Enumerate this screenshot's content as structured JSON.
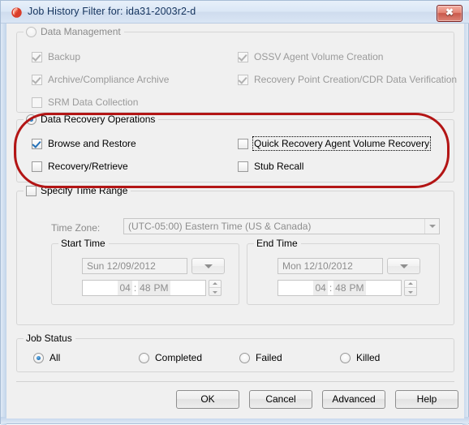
{
  "window": {
    "title": "Job History Filter for: ida31-2003r2-d",
    "icon": "commvault-swirl-icon",
    "close_label": "✖",
    "accent_close": "#c9584a",
    "frame_color": "#cfdcee"
  },
  "annotation": {
    "shape": "rounded-rectangle",
    "color": "#b31515",
    "targets": "Data Recovery Operations group"
  },
  "groups": {
    "data_management": {
      "title": "Data Management",
      "selected": false,
      "enabled": false,
      "options": [
        {
          "label": "Backup",
          "checked": true,
          "enabled": false
        },
        {
          "label": "Archive/Compliance Archive",
          "checked": true,
          "enabled": false
        },
        {
          "label": "SRM Data Collection",
          "checked": false,
          "enabled": false
        },
        {
          "label": "OSSV Agent Volume Creation",
          "checked": true,
          "enabled": false
        },
        {
          "label": "Recovery Point Creation/CDR Data Verification",
          "checked": true,
          "enabled": false
        }
      ]
    },
    "data_recovery": {
      "title": "Data Recovery Operations",
      "selected": true,
      "enabled": true,
      "options": [
        {
          "label": "Browse and Restore",
          "checked": true,
          "enabled": true,
          "focused": false
        },
        {
          "label": "Recovery/Retrieve",
          "checked": false,
          "enabled": true,
          "focused": false
        },
        {
          "label": "Quick Recovery Agent Volume Recovery",
          "checked": false,
          "enabled": true,
          "focused": true
        },
        {
          "label": "Stub Recall",
          "checked": false,
          "enabled": true,
          "focused": false
        }
      ]
    },
    "time_range": {
      "title": "Specify Time Range",
      "checked": false,
      "enabled": true,
      "timezone_label": "Time Zone:",
      "timezone_value": "(UTC-05:00) Eastern Time (US & Canada)",
      "start": {
        "title": "Start Time",
        "date": "Sun 12/09/2012",
        "hour": "04",
        "separator": ":",
        "minute": "48",
        "meridiem": "PM"
      },
      "end": {
        "title": "End Time",
        "date": "Mon 12/10/2012",
        "hour": "04",
        "separator": ":",
        "minute": "48",
        "meridiem": "PM"
      }
    },
    "job_status": {
      "title": "Job Status",
      "options": [
        {
          "label": "All",
          "selected": true
        },
        {
          "label": "Completed",
          "selected": false
        },
        {
          "label": "Failed",
          "selected": false
        },
        {
          "label": "Killed",
          "selected": false
        }
      ]
    }
  },
  "buttons": {
    "ok": "OK",
    "cancel": "Cancel",
    "advanced": "Advanced",
    "help": "Help"
  }
}
